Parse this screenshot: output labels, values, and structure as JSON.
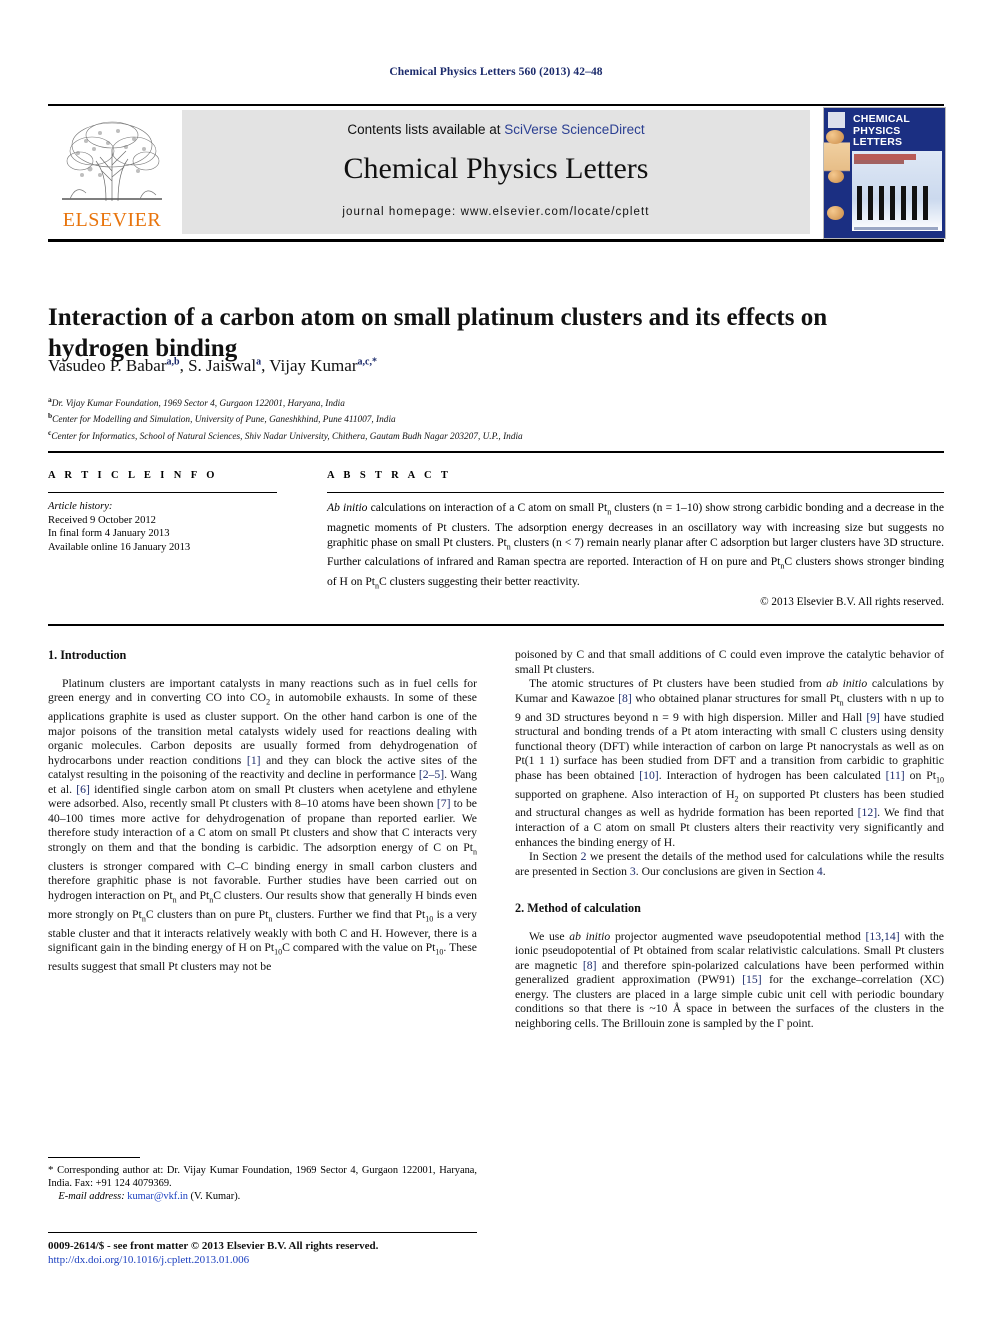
{
  "running_head": "Chemical Physics Letters 560 (2013) 42–48",
  "masthead": {
    "contents_prefix": "Contents lists available at ",
    "contents_link": "SciVerse ScienceDirect",
    "journal_title": "Chemical Physics Letters",
    "homepage": "journal homepage: www.elsevier.com/locate/cplett",
    "publisher_name": "ELSEVIER",
    "cover_title_line1": "CHEMICAL",
    "cover_title_line2": "PHYSICS",
    "cover_title_line3": "LETTERS"
  },
  "article": {
    "title": "Interaction of a carbon atom on small platinum clusters and its effects on hydrogen binding",
    "authors": [
      {
        "name": "Vasudeo P. Babar",
        "marks": "a,b"
      },
      {
        "name": "S. Jaiswal",
        "marks": "a"
      },
      {
        "name": "Vijay Kumar",
        "marks": "a,c,*"
      }
    ],
    "affiliations": [
      {
        "mark": "a",
        "text": "Dr. Vijay Kumar Foundation, 1969 Sector 4, Gurgaon 122001, Haryana, India"
      },
      {
        "mark": "b",
        "text": "Center for Modelling and Simulation, University of Pune, Ganeshkhind, Pune 411007, India"
      },
      {
        "mark": "c",
        "text": "Center for Informatics, School of Natural Sciences, Shiv Nadar University, Chithera, Gautam Budh Nagar 203207, U.P., India"
      }
    ]
  },
  "info": {
    "label": "A R T I C L E  I N F O",
    "history_title": "Article history:",
    "history": [
      "Received 9 October 2012",
      "In final form 4 January 2013",
      "Available online 16 January 2013"
    ]
  },
  "abstract": {
    "label": "A B S T R A C T",
    "lead_italic": "Ab initio",
    "text": " calculations on interaction of a C atom on small Ptn clusters (n = 1–10) show strong carbidic bonding and a decrease in the magnetic moments of Pt clusters. The adsorption energy decreases in an oscillatory way with increasing size but suggests no graphitic phase on small Pt clusters. Ptn clusters (n < 7) remain nearly planar after C adsorption but larger clusters have 3D structure. Further calculations of infrared and Raman spectra are reported. Interaction of H on pure and PtnC clusters shows stronger binding of H on PtnC clusters suggesting their better reactivity.",
    "copyright": "© 2013 Elsevier B.V. All rights reserved."
  },
  "sections": {
    "intro_heading": "1. Introduction",
    "method_heading": "2. Method of calculation"
  },
  "body": {
    "left_p1": "Platinum clusters are important catalysts in many reactions such as in fuel cells for green energy and in converting CO into CO2 in automobile exhausts. In some of these applications graphite is used as cluster support. On the other hand carbon is one of the major poisons of the transition metal catalysts widely used for reactions dealing with organic molecules. Carbon deposits are usually formed from dehydrogenation of hydrocarbons under reaction conditions [1] and they can block the active sites of the catalyst resulting in the poisoning of the reactivity and decline in performance [2–5]. Wang et al. [6] identified single carbon atom on small Pt clusters when acetylene and ethylene were adsorbed. Also, recently small Pt clusters with 8–10 atoms have been shown [7] to be 40–100 times more active for dehydrogenation of propane than reported earlier. We therefore study interaction of a C atom on small Pt clusters and show that C interacts very strongly on them and that the bonding is carbidic. The adsorption energy of C on Ptn clusters is stronger compared with C–C binding energy in small carbon clusters and therefore graphitic phase is not favorable. Further studies have been carried out on hydrogen interaction on Ptn and PtnC clusters. Our results show that generally H binds even more strongly on PtnC clusters than on pure Ptn clusters. Further we find that Pt10 is a very stable cluster and that it interacts relatively weakly with both C and H. However, there is a significant gain in the binding energy of H on Pt10C compared with the value on Pt10. These results suggest that small Pt clusters may not be",
    "right_p1_cont": "poisoned by C and that small additions of C could even improve the catalytic behavior of small Pt clusters.",
    "right_p2": "The atomic structures of Pt clusters have been studied from ab initio calculations by Kumar and Kawazoe [8] who obtained planar structures for small Ptn clusters with n up to 9 and 3D structures beyond n = 9 with high dispersion. Miller and Hall [9] have studied structural and bonding trends of a Pt atom interacting with small C clusters using density functional theory (DFT) while interaction of carbon on large Pt nanocrystals as well as on Pt(1 1 1) surface has been studied from DFT and a transition from carbidic to graphitic phase has been obtained [10]. Interaction of hydrogen has been calculated [11] on Pt10 supported on graphene. Also interaction of H2 on supported Pt clusters has been studied and structural changes as well as hydride formation has been reported [12]. We find that interaction of a C atom on small Pt clusters alters their reactivity very significantly and enhances the binding energy of H.",
    "right_p3": "In Section 2 we present the details of the method used for calculations while the results are presented in Section 3. Our conclusions are given in Section 4.",
    "right_p4": "We use ab initio projector augmented wave pseudopotential method [13,14] with the ionic pseudopotential of Pt obtained from scalar relativistic calculations. Small Pt clusters are magnetic [8] and therefore spin-polarized calculations have been performed within generalized gradient approximation (PW91) [15] for the exchange–correlation (XC) energy. The clusters are placed in a large simple cubic unit cell with periodic boundary conditions so that there is ~10 Å space in between the surfaces of the clusters in the neighboring cells. The Brillouin zone is sampled by the Γ point."
  },
  "footnote": {
    "star": "*",
    "corresponding": " Corresponding author at: Dr. Vijay Kumar Foundation, 1969 Sector 4, Gurgaon 122001, Haryana, India. Fax: +91 124 4079369.",
    "email_label": "E-mail address:",
    "email": "kumar@vkf.in",
    "email_suffix": " (V. Kumar)."
  },
  "footer": {
    "issn_line": "0009-2614/$ - see front matter © 2013 Elsevier B.V. All rights reserved.",
    "doi": "http://dx.doi.org/10.1016/j.cplett.2013.01.006"
  },
  "colors": {
    "link_blue": "#1b3fbf",
    "ref_blue": "#1b2a6b",
    "elsevier_orange": "#E8740C",
    "masthead_grey": "#e3e3e3",
    "cover_blue": "#1b2f82"
  }
}
